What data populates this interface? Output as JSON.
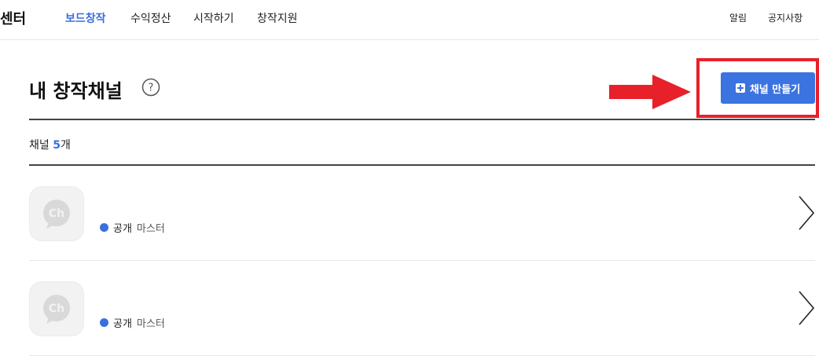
{
  "brand": "센터",
  "nav": [
    {
      "label": "보드창작",
      "active": true
    },
    {
      "label": "수익정산",
      "active": false
    },
    {
      "label": "시작하기",
      "active": false
    },
    {
      "label": "창작지원",
      "active": false
    }
  ],
  "util": [
    "알림",
    "공지사항"
  ],
  "page": {
    "title": "내 창작채널",
    "help_symbol": "?",
    "create_button_label": "채널 만들기"
  },
  "count": {
    "label": "채널",
    "value": "5",
    "unit": "개"
  },
  "channels": [
    {
      "avatar_text": "Ch",
      "visibility": "공개",
      "role": "마스터"
    },
    {
      "avatar_text": "Ch",
      "visibility": "공개",
      "role": "마스터"
    }
  ],
  "colors": {
    "accent": "#3b73e0",
    "annotation": "#e8202a"
  }
}
